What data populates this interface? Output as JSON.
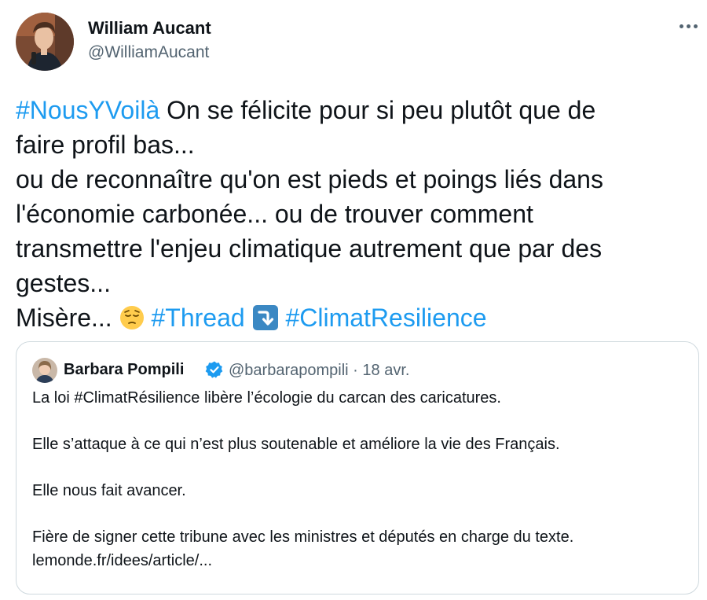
{
  "author": {
    "name": "William Aucant",
    "handle": "@WilliamAucant"
  },
  "tweet": {
    "tag1": "#NousYVoilà",
    "line1_rest": " On se félicite pour si peu plutôt que de",
    "line2": "faire profil bas...",
    "line3": "ou de reconnaître qu'on est pieds et poings liés dans",
    "line4": "l'économie carbonée... ou de trouver comment",
    "line5": "transmettre l'enjeu climatique autrement que par des",
    "line6": "gestes...",
    "line7_start": "Misère... ",
    "tag2": "#Thread",
    "tag3": "#ClimatResilience"
  },
  "quoted": {
    "name": "Barbara Pompili",
    "handle": "@barbarapompili",
    "separator": " · ",
    "date": "18 avr.",
    "para1": "La loi #ClimatRésilience libère l’écologie du carcan des caricatures.",
    "para2": "Elle s’attaque à ce qui n’est plus soutenable et améliore la vie des Français.",
    "para3": "Elle nous fait avancer.",
    "para4": "Fière de signer cette tribune avec les ministres et députés en charge du texte.",
    "link": "lemonde.fr/idees/article/..."
  },
  "colors": {
    "hashtag": "#1d9bf0",
    "text": "#0f1419",
    "secondary": "#536471",
    "border": "#cfd9de",
    "verified": "#1d9bf0"
  },
  "icons": {
    "more": "more-horizontal-icon",
    "emoji1": "pensive-face-emoji",
    "emoji2": "right-arrow-curving-down-emoji",
    "badge": "verified-badge-icon"
  }
}
